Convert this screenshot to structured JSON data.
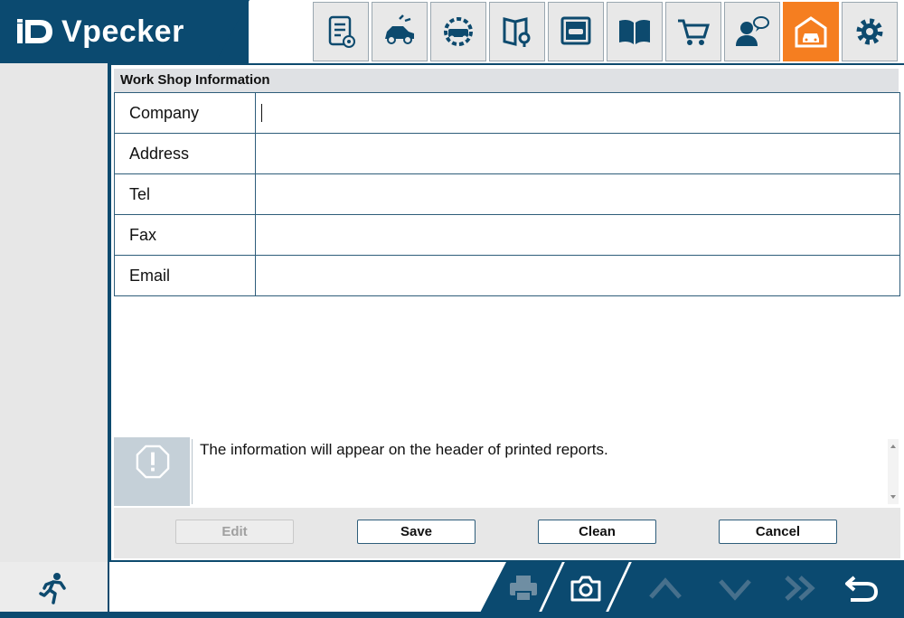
{
  "app": {
    "brand": "Vpecker"
  },
  "toolbar": {
    "items": [
      {
        "icon": "report-settings-icon"
      },
      {
        "icon": "car-diagnosis-icon"
      },
      {
        "icon": "car-service-icon"
      },
      {
        "icon": "book-search-icon"
      },
      {
        "icon": "car-screen-icon"
      },
      {
        "icon": "manual-book-icon"
      },
      {
        "icon": "shopping-cart-icon"
      },
      {
        "icon": "user-chat-icon"
      },
      {
        "icon": "workshop-garage-icon",
        "active": true
      },
      {
        "icon": "gear-icon"
      }
    ],
    "active_color": "#f57e20"
  },
  "panel": {
    "title": "Work Shop Information",
    "fields": [
      {
        "label": "Company",
        "value": ""
      },
      {
        "label": "Address",
        "value": ""
      },
      {
        "label": "Tel",
        "value": ""
      },
      {
        "label": "Fax",
        "value": ""
      },
      {
        "label": "Email",
        "value": ""
      }
    ],
    "info_text": "The information will appear on the header of printed reports."
  },
  "actions": {
    "edit": "Edit",
    "save": "Save",
    "clean": "Clean",
    "cancel": "Cancel"
  },
  "footer": {
    "icons": [
      "running-man-icon",
      "printer-icon",
      "camera-icon",
      "chevron-up-icon",
      "chevron-down-icon",
      "double-chevron-right-icon",
      "back-arrow-icon"
    ]
  },
  "colors": {
    "primary": "#0b4a70",
    "accent": "#f57e20"
  }
}
